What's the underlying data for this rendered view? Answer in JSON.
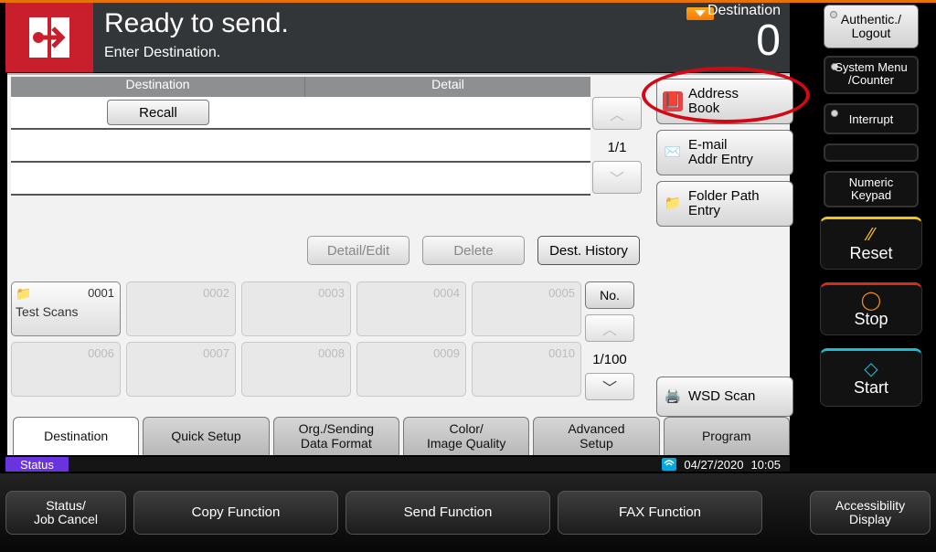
{
  "header": {
    "title": "Ready to send.",
    "subtitle": "Enter Destination.",
    "dest_label": "Destination",
    "dest_count": "0"
  },
  "rail": {
    "auth": "Authentic./\nLogout",
    "system_menu": "System Menu\n/Counter",
    "interrupt": "Interrupt",
    "numeric": "Numeric\nKeypad",
    "reset": "Reset",
    "stop": "Stop",
    "start": "Start"
  },
  "columns": {
    "dest": "Destination",
    "detail": "Detail"
  },
  "recall": "Recall",
  "page_dest": "1/1",
  "entry": {
    "address_book": "Address\nBook",
    "email": "E-mail\nAddr Entry",
    "folder": "Folder Path\nEntry",
    "wsd": "WSD Scan"
  },
  "actions": {
    "detail_edit": "Detail/Edit",
    "delete": "Delete",
    "history": "Dest. History"
  },
  "quickdial": [
    {
      "num": "0001",
      "label": "Test Scans",
      "active": true
    },
    {
      "num": "0002",
      "label": "",
      "active": false
    },
    {
      "num": "0003",
      "label": "",
      "active": false
    },
    {
      "num": "0004",
      "label": "",
      "active": false
    },
    {
      "num": "0005",
      "label": "",
      "active": false
    },
    {
      "num": "0006",
      "label": "",
      "active": false
    },
    {
      "num": "0007",
      "label": "",
      "active": false
    },
    {
      "num": "0008",
      "label": "",
      "active": false
    },
    {
      "num": "0009",
      "label": "",
      "active": false
    },
    {
      "num": "0010",
      "label": "",
      "active": false
    }
  ],
  "qd_no": "No.",
  "qd_page": "1/100",
  "tabs": {
    "destination": "Destination",
    "quick_setup": "Quick Setup",
    "org": "Org./Sending\nData Format",
    "color": "Color/\nImage Quality",
    "advanced": "Advanced\nSetup",
    "program": "Program"
  },
  "status": {
    "tag": "Status",
    "date": "04/27/2020",
    "time": "10:05"
  },
  "bottom": {
    "status_cancel": "Status/\nJob Cancel",
    "copy": "Copy Function",
    "send": "Send Function",
    "fax": "FAX Function",
    "access": "Accessibility\nDisplay"
  }
}
